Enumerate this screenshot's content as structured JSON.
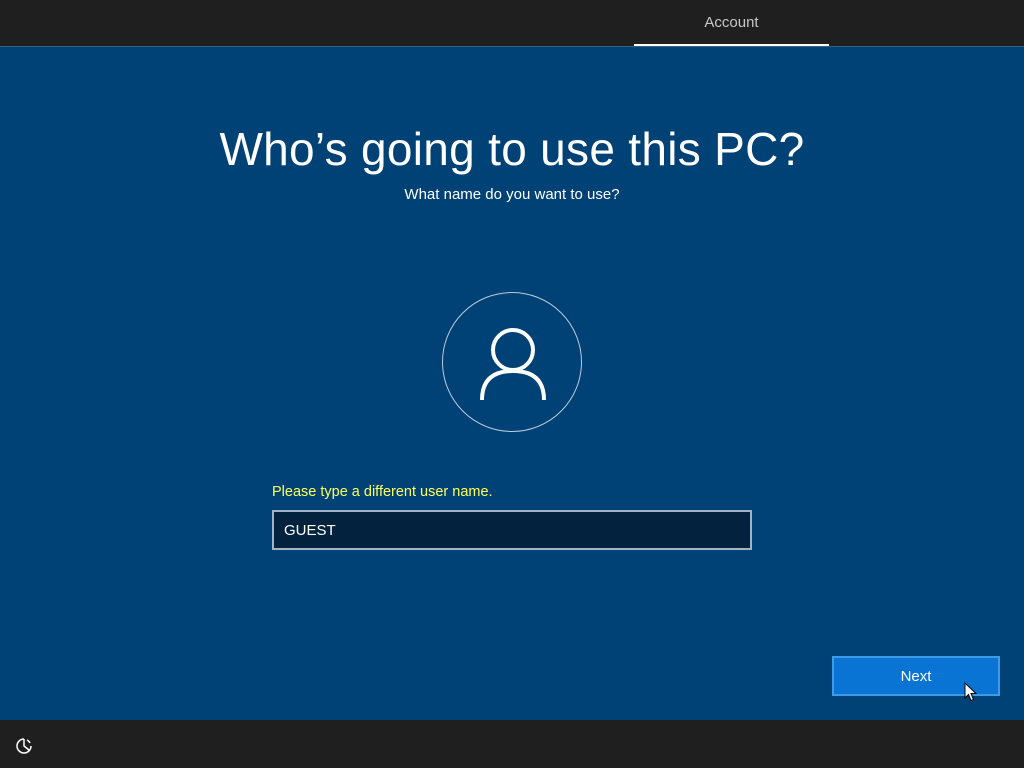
{
  "header": {
    "step_label": "Account"
  },
  "main": {
    "title": "Who’s going to use this PC?",
    "subtitle": "What name do you want to use?",
    "avatar_icon": "user-icon",
    "error_message": "Please type a different user name.",
    "username_value": "GUEST",
    "next_label": "Next"
  },
  "footer": {
    "ease_of_access_icon": "ease-of-access-icon"
  },
  "colors": {
    "background": "#004275",
    "bar": "#1f1f1f",
    "accent_button": "#0a74d4",
    "error_text": "#ffff5a"
  }
}
